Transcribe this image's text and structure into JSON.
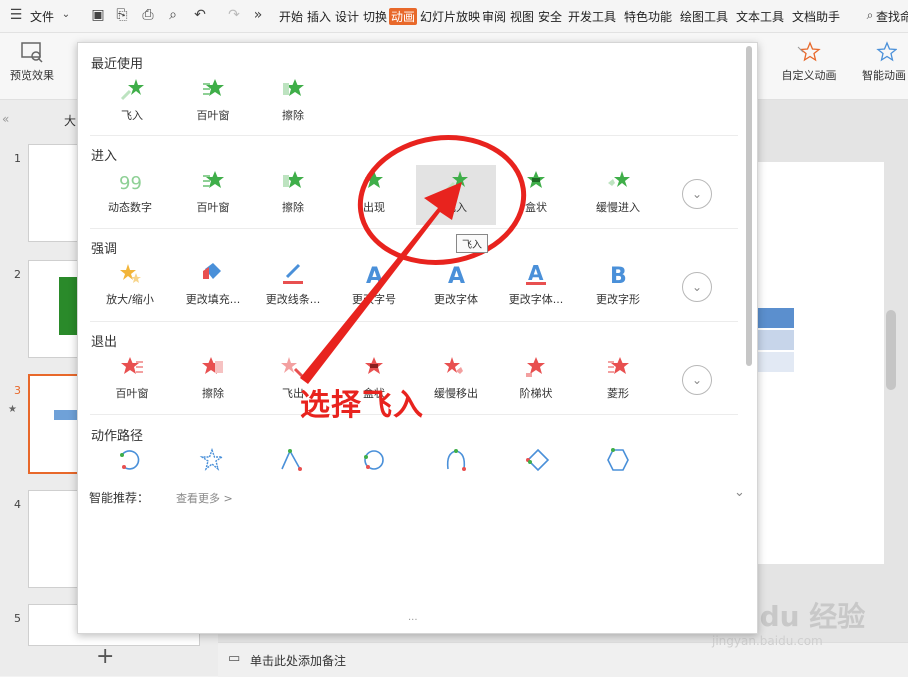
{
  "menubar": {
    "file": "文件",
    "tabs": [
      "开始",
      "插入",
      "设计",
      "切换",
      "动画",
      "幻灯片放映",
      "审阅",
      "视图",
      "安全",
      "开发工具",
      "特色功能",
      "绘图工具",
      "文本工具",
      "文档助手"
    ],
    "active_tab": "动画",
    "search": "查找命"
  },
  "ribbon": {
    "preview": "预览效果",
    "custom_anim": "自定义动画",
    "smart_anim": "智能动画"
  },
  "popup": {
    "recent": {
      "title": "最近使用",
      "items": [
        "飞入",
        "百叶窗",
        "擦除"
      ]
    },
    "enter": {
      "title": "进入",
      "items": [
        "动态数字",
        "百叶窗",
        "擦除",
        "出现",
        "飞入",
        "盒状",
        "缓慢进入"
      ]
    },
    "emphasis": {
      "title": "强调",
      "items": [
        "放大/缩小",
        "更改填充...",
        "更改线条...",
        "更改字号",
        "更改字体",
        "更改字体...",
        "更改字形"
      ]
    },
    "exit": {
      "title": "退出",
      "items": [
        "百叶窗",
        "擦除",
        "飞出",
        "盒状",
        "缓慢移出",
        "阶梯状",
        "菱形"
      ]
    },
    "path": {
      "title": "动作路径"
    },
    "smart": {
      "label": "智能推荐：",
      "more": "查看更多 >"
    },
    "tooltip": "飞入",
    "dots": "···"
  },
  "annotation": "选择飞入",
  "slides": [
    "1",
    "2",
    "3",
    "4",
    "5"
  ],
  "left_label": "大",
  "notes": "单击此处添加备注",
  "add_slide": "+",
  "watermark": "Bai du 经验",
  "watermark_url": "jingyan.baidu.com",
  "colors": {
    "accent": "#e8682a",
    "arrow": "#e8231e",
    "green": "#3fae49",
    "blue": "#4a90d9",
    "red": "#e85050"
  }
}
